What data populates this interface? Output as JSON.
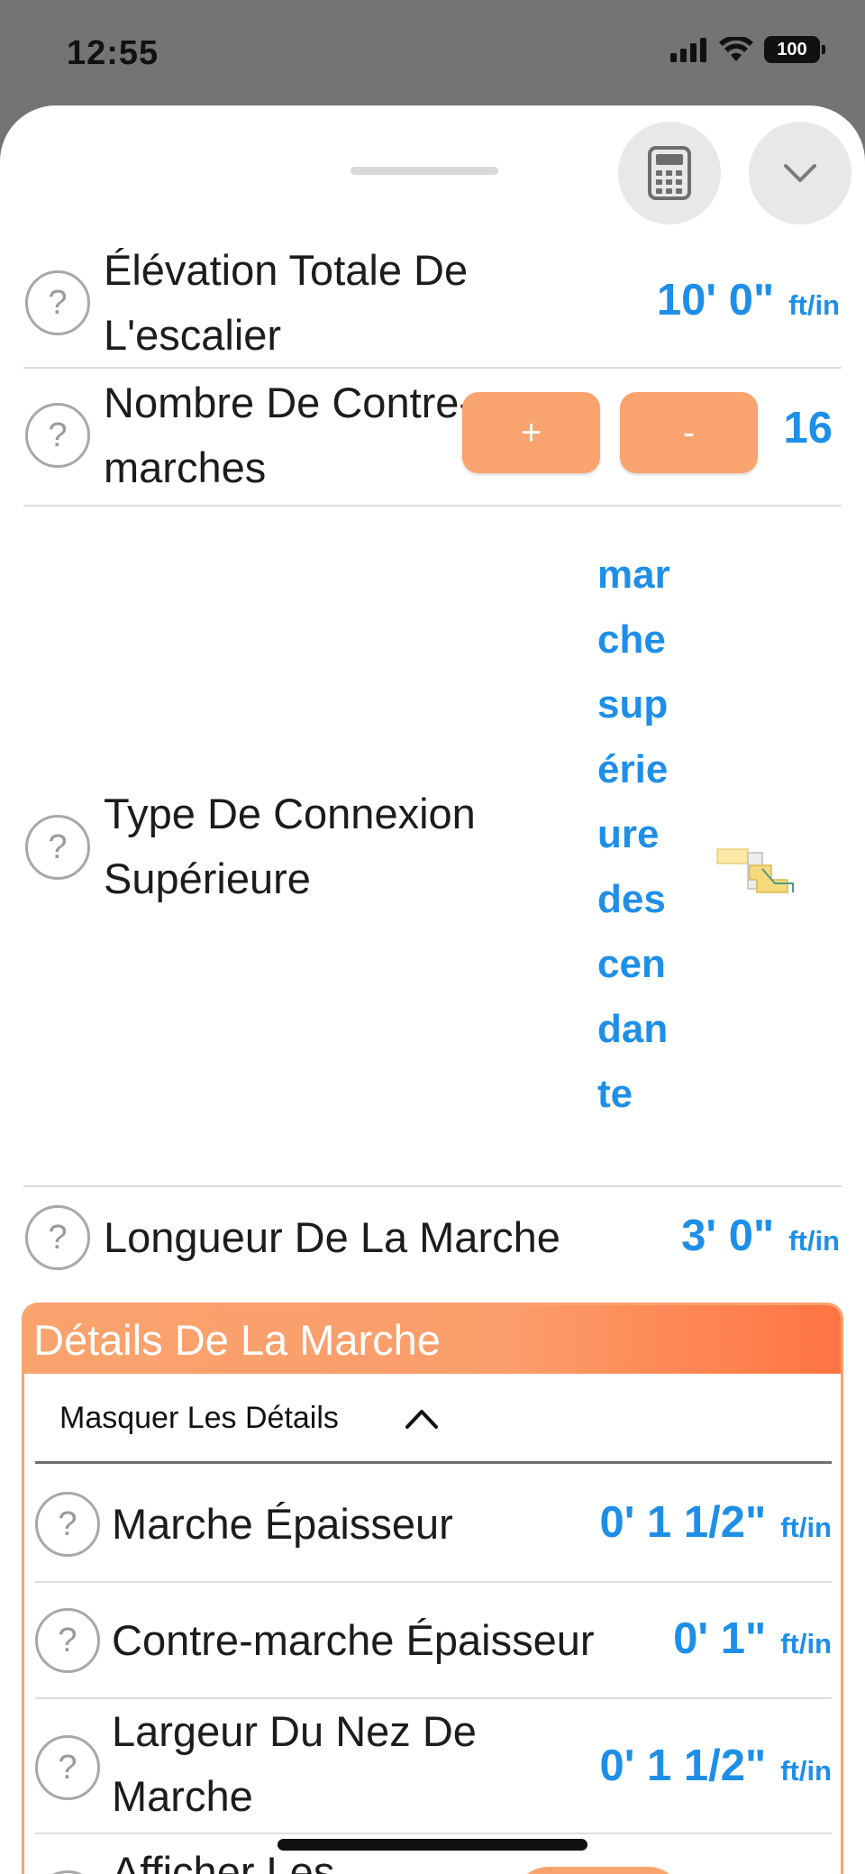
{
  "status_bar": {
    "time": "12:55",
    "battery": "100"
  },
  "rows": {
    "elevation": {
      "label": "Élévation Totale De L'escalier",
      "value": "10' 0\"",
      "unit": "ft/in"
    },
    "risers": {
      "label": "Nombre De Contre-marches",
      "plus": "+",
      "minus": "-",
      "value": "16"
    },
    "connection": {
      "label": "Type De Connexion Supérieure",
      "value": "mar che sup érie ure des cen dan te"
    },
    "length": {
      "label": "Longueur De La Marche",
      "value": "3' 0\"",
      "unit": "ft/in"
    }
  },
  "details": {
    "title": "Détails De La Marche",
    "toggle_label": "Masquer Les Détails",
    "rows": [
      {
        "label": "Marche Épaisseur",
        "value": "0' 1 1/2\"",
        "unit": "ft/in"
      },
      {
        "label": "Contre-marche Épaisseur",
        "value": "0' 1\"",
        "unit": "ft/in"
      },
      {
        "label": "Largeur Du Nez De Marche",
        "value": "0' 1 1/2\"",
        "unit": "ft/in"
      },
      {
        "label": "Afficher Les"
      }
    ]
  },
  "help_glyph": "?",
  "colors": {
    "accent_blue": "#1e8fe8",
    "accent_orange": "#f9a36e",
    "header_orange_end": "#ff7442"
  }
}
